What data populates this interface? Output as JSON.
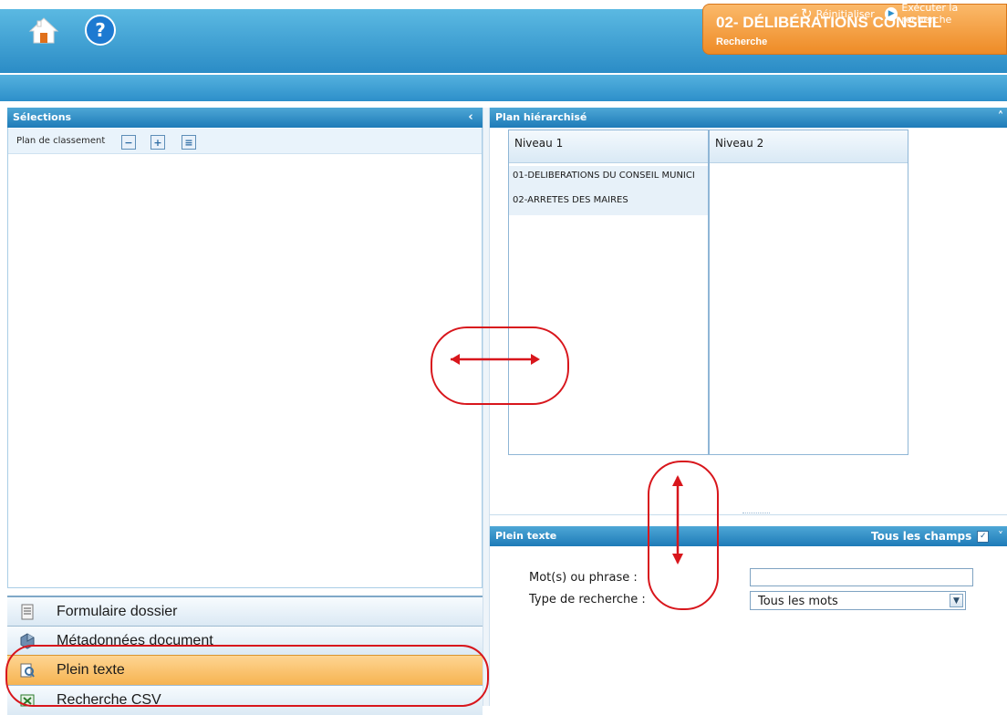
{
  "header": {
    "module_title": "02- DÉLIBÉRATIONS CONSEIL",
    "module_subtitle": "Recherche",
    "home_icon": "home-icon",
    "help_icon": "help-icon"
  },
  "toolbar": {
    "reset_label": "Réinitialiser",
    "run_label": "Exécuter la recherche"
  },
  "selections": {
    "title": "Sélections",
    "tools_label": "Plan de classement"
  },
  "plan": {
    "title": "Plan hiérarchisé",
    "columns": [
      {
        "header": "Niveau 1",
        "rows": [
          "01-DELIBERATIONS DU CONSEIL MUNICI",
          "02-ARRETES DES MAIRES"
        ]
      },
      {
        "header": "Niveau 2",
        "rows": []
      }
    ]
  },
  "fulltext": {
    "title": "Plein texte",
    "all_fields_label": "Tous les champs",
    "words_label": "Mot(s) ou phrase :",
    "words_value": "",
    "type_label": "Type de recherche :",
    "type_value": "Tous les mots"
  },
  "accordion": {
    "items": [
      {
        "label": "Formulaire dossier",
        "icon": "form-icon"
      },
      {
        "label": "Métadonnées document",
        "icon": "metadata-icon"
      },
      {
        "label": "Plein texte",
        "icon": "fulltext-icon",
        "selected": true
      },
      {
        "label": "Recherche CSV",
        "icon": "csv-icon"
      }
    ]
  },
  "colors": {
    "header_blue": "#2b8cc6",
    "module_orange": "#ee8b26",
    "selected_orange": "#f6b351",
    "annotation_red": "#d8161c"
  }
}
